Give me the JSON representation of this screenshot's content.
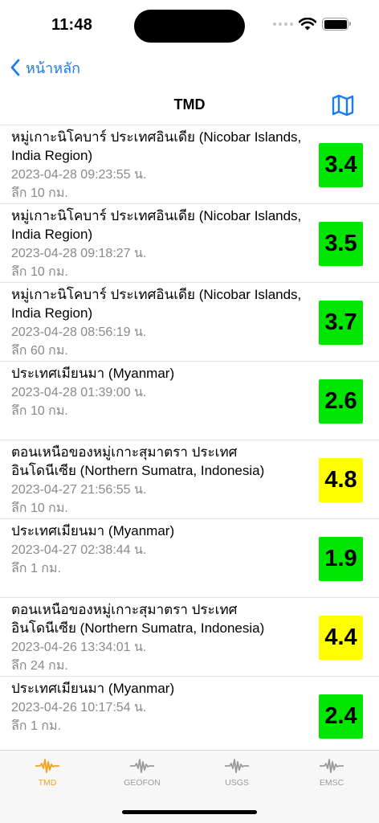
{
  "status": {
    "time": "11:48"
  },
  "nav": {
    "back_label": "หน้าหลัก",
    "title": "TMD"
  },
  "colors": {
    "accent": "#1a7bf2",
    "tab_active": "#f7a11b",
    "mag_green": "#00e600",
    "mag_yellow": "#ffff00"
  },
  "quakes": [
    {
      "place": "หมู่เกาะนิโคบาร์ ประเทศอินเดีย (Nicobar Islands, India Region)",
      "time": "2023-04-28 09:23:55 น.",
      "depth": "ลึก 10 กม.",
      "magnitude": "3.4",
      "color": "#00e600"
    },
    {
      "place": "หมู่เกาะนิโคบาร์ ประเทศอินเดีย (Nicobar Islands, India Region)",
      "time": "2023-04-28 09:18:27 น.",
      "depth": "ลึก 10 กม.",
      "magnitude": "3.5",
      "color": "#00e600"
    },
    {
      "place": "หมู่เกาะนิโคบาร์ ประเทศอินเดีย (Nicobar Islands, India Region)",
      "time": "2023-04-28 08:56:19 น.",
      "depth": "ลึก 60 กม.",
      "magnitude": "3.7",
      "color": "#00e600"
    },
    {
      "place": "ประเทศเมียนมา (Myanmar)",
      "time": "2023-04-28 01:39:00 น.",
      "depth": "ลึก 10 กม.",
      "magnitude": "2.6",
      "color": "#00e600"
    },
    {
      "place": "ตอนเหนือของหมู่เกาะสุมาตรา ประเทศอินโดนีเซีย (Northern Sumatra, Indonesia)",
      "time": "2023-04-27 21:56:55 น.",
      "depth": "ลึก 10 กม.",
      "magnitude": "4.8",
      "color": "#ffff00"
    },
    {
      "place": "ประเทศเมียนมา (Myanmar)",
      "time": "2023-04-27 02:38:44 น.",
      "depth": "ลึก 1 กม.",
      "magnitude": "1.9",
      "color": "#00e600"
    },
    {
      "place": "ตอนเหนือของหมู่เกาะสุมาตรา ประเทศอินโดนีเซีย (Northern Sumatra, Indonesia)",
      "time": "2023-04-26 13:34:01 น.",
      "depth": "ลึก 24 กม.",
      "magnitude": "4.4",
      "color": "#ffff00"
    },
    {
      "place": "ประเทศเมียนมา (Myanmar)",
      "time": "2023-04-26 10:17:54 น.",
      "depth": "ลึก 1 กม.",
      "magnitude": "2.4",
      "color": "#00e600"
    }
  ],
  "tabs": [
    {
      "label": "TMD",
      "icon": "seismograph-icon",
      "active": true
    },
    {
      "label": "GEOFON",
      "icon": "seismograph-icon",
      "active": false
    },
    {
      "label": "USGS",
      "icon": "seismograph-icon",
      "active": false
    },
    {
      "label": "EMSC",
      "icon": "seismograph-icon",
      "active": false
    }
  ]
}
